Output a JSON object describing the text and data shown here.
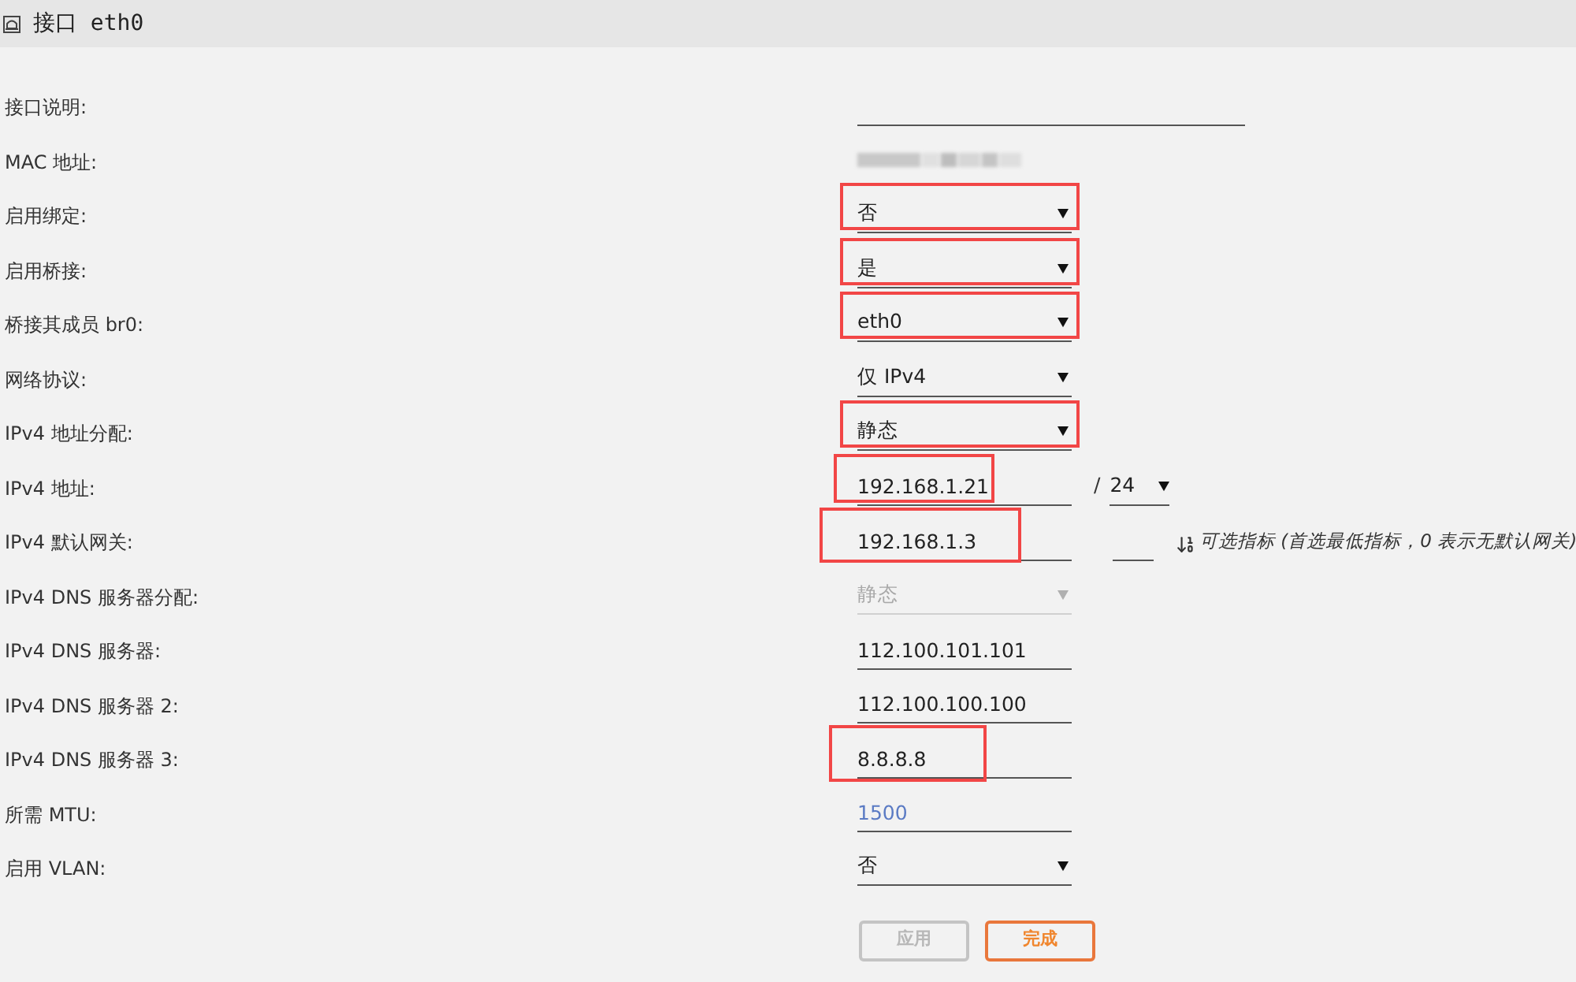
{
  "header": {
    "title": "接口 eth0"
  },
  "rows": [
    {
      "label": "接口说明:",
      "kind": "wide_text",
      "highlighted": false,
      "disabled": false
    },
    {
      "label": "MAC 地址:",
      "kind": "redacted",
      "highlighted": false,
      "disabled": false
    },
    {
      "label": "启用绑定:",
      "kind": "select",
      "value": "否",
      "highlighted": true,
      "disabled": false
    },
    {
      "label": "启用桥接:",
      "kind": "select",
      "value": "是",
      "highlighted": true,
      "disabled": false
    },
    {
      "label": "桥接其成员 br0:",
      "kind": "select",
      "value": "eth0",
      "highlighted": true,
      "disabled": false
    },
    {
      "label": "网络协议:",
      "kind": "select",
      "value": "仅 IPv4",
      "highlighted": false,
      "disabled": false
    },
    {
      "label": "IPv4 地址分配:",
      "kind": "select",
      "value": "静态",
      "highlighted": true,
      "disabled": false
    },
    {
      "label": "IPv4 地址:",
      "kind": "address",
      "value": "192.168.1.21",
      "separator": "/",
      "prefix": "24",
      "highlighted": true,
      "disabled": false
    },
    {
      "label": "IPv4 默认网关:",
      "kind": "gateway",
      "value": "192.168.1.3",
      "hint": "可选指标 (首选最低指标，0 表示无默认网关)",
      "highlighted": true,
      "disabled": false
    },
    {
      "label": "IPv4 DNS 服务器分配:",
      "kind": "select",
      "value": "静态",
      "highlighted": false,
      "disabled": true
    },
    {
      "label": "IPv4 DNS 服务器:",
      "kind": "text",
      "value": "112.100.101.101",
      "highlighted": false,
      "disabled": false
    },
    {
      "label": "IPv4 DNS 服务器 2:",
      "kind": "text",
      "value": "112.100.100.100",
      "highlighted": false,
      "disabled": false
    },
    {
      "label": "IPv4 DNS 服务器 3:",
      "kind": "text",
      "value": "8.8.8.8",
      "highlighted": true,
      "disabled": false
    },
    {
      "label": "所需 MTU:",
      "kind": "text",
      "placeholder": "1500",
      "highlighted": false,
      "disabled": false
    },
    {
      "label": "启用 VLAN:",
      "kind": "select",
      "value": "否",
      "highlighted": false,
      "disabled": false
    }
  ],
  "buttons": [
    {
      "label": "应用",
      "kind": "apply",
      "disabled": true
    },
    {
      "label": "完成",
      "kind": "done",
      "disabled": false
    }
  ]
}
